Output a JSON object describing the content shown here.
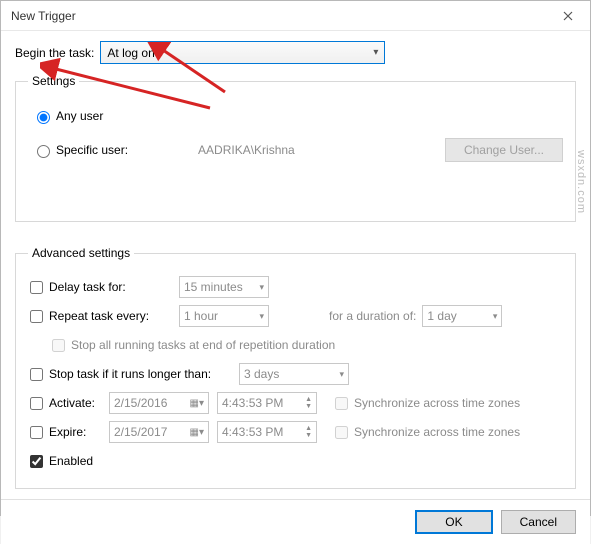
{
  "window": {
    "title": "New Trigger"
  },
  "begin": {
    "label": "Begin the task:",
    "selected": "At log on"
  },
  "settings": {
    "legend": "Settings",
    "any_user": "Any user",
    "specific_user": "Specific user:",
    "specific_value": "AADRIKA\\Krishna",
    "change_user": "Change User...",
    "user_choice": "any"
  },
  "advanced": {
    "legend": "Advanced settings",
    "delay_label": "Delay task for:",
    "delay_value": "15 minutes",
    "delay_checked": false,
    "repeat_label": "Repeat task every:",
    "repeat_value": "1 hour",
    "repeat_checked": false,
    "duration_label": "for a duration of:",
    "duration_value": "1 day",
    "stop_all_label": "Stop all running tasks at end of repetition duration",
    "stop_longer_label": "Stop task if it runs longer than:",
    "stop_longer_value": "3 days",
    "stop_longer_checked": false,
    "activate_label": "Activate:",
    "activate_date": "2/15/2016",
    "activate_time": "4:43:53 PM",
    "activate_checked": false,
    "expire_label": "Expire:",
    "expire_date": "2/15/2017",
    "expire_time": "4:43:53 PM",
    "expire_checked": false,
    "sync_label": "Synchronize across time zones",
    "enabled_label": "Enabled",
    "enabled_checked": true
  },
  "footer": {
    "ok": "OK",
    "cancel": "Cancel"
  },
  "watermark": "wsxdn.com"
}
